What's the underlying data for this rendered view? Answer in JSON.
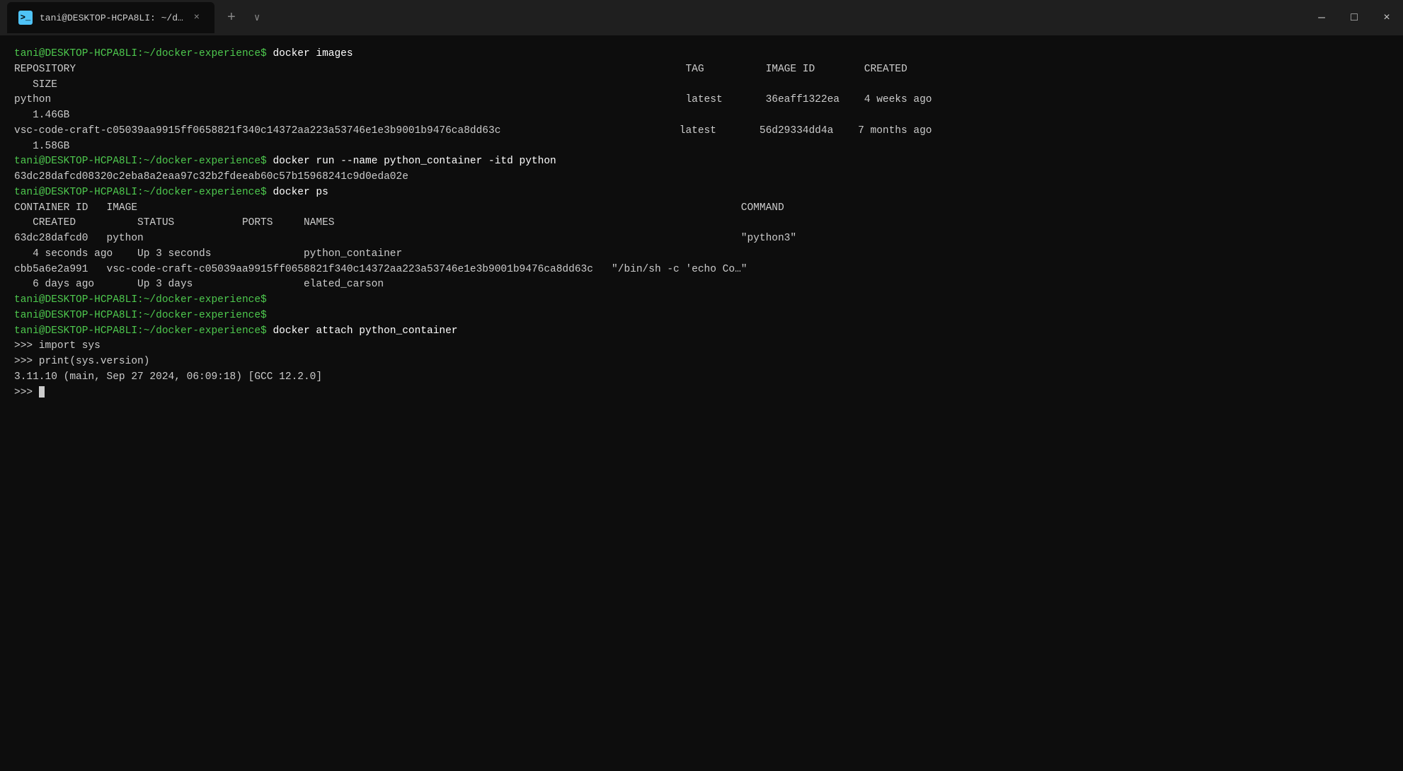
{
  "titlebar": {
    "tab_title": "tani@DESKTOP-HCPA8LI: ~/d…",
    "tab_icon": ">_",
    "close_label": "×",
    "minimize_label": "—",
    "maximize_label": "□",
    "new_tab_label": "+",
    "dropdown_label": "∨"
  },
  "terminal": {
    "prompt1": "tani@DESKTOP-HCPA8LI:~/docker-experience$",
    "cmd1": " docker images",
    "header_row": "REPOSITORY                                                                                                   TAG          IMAGE ID        CREATED",
    "header_size": "   SIZE",
    "img1_repo": "python",
    "img1_tag": "latest",
    "img1_id": "36eaff1322ea",
    "img1_created": "4 weeks ago",
    "img1_size": "   1.46GB",
    "img2_repo": "vsc-code-craft-c05039aa9915ff0658821f340c14372aa223a53746e1e3b9001b9476ca8dd63c",
    "img2_tag": "latest",
    "img2_id": "56d29334dd4a",
    "img2_created": "7 months ago",
    "img2_size": "   1.58GB",
    "prompt2": "tani@DESKTOP-HCPA8LI:~/docker-experience$",
    "cmd2": " docker run --name python_container -itd python",
    "container_hash": "63dc28dafcd08320c2eba8a2eaa97c32b2fdeeab60c57b15968241c9d0eda02e",
    "prompt3": "tani@DESKTOP-HCPA8LI:~/docker-experience$",
    "cmd3": " docker ps",
    "ps_header1": "CONTAINER ID   IMAGE                                                                                                  COMMAND",
    "ps_header2": "   CREATED          STATUS           PORTS     NAMES",
    "container1_id": "63dc28dafcd0",
    "container1_image": "python",
    "container1_command": "\"python3\"",
    "container1_created": "   4 seconds ago",
    "container1_status": "  Up 3 seconds",
    "container1_ports": "",
    "container1_names": "   python_container",
    "container2_id": "cbb5a6e2a991",
    "container2_image": "vsc-code-craft-c05039aa9915ff0658821f340c14372aa223a53746e1e3b9001b9476ca8dd63c",
    "container2_command": "\"/bin/sh -c 'echo Co…\"",
    "container2_created": "   6 days ago",
    "container2_status": "  Up 3 days",
    "container2_ports": "",
    "container2_names": "   elated_carson",
    "prompt4": "tani@DESKTOP-HCPA8LI:~/docker-experience$",
    "prompt5": "tani@DESKTOP-HCPA8LI:~/docker-experience$",
    "prompt6": "tani@DESKTOP-HCPA8LI:~/docker-experience$",
    "cmd6": " docker attach python_container",
    "repl1": ">>> import sys",
    "repl2": ">>> print(sys.version)",
    "repl_output": "3.11.10 (main, Sep 27 2024, 06:09:18) [GCC 12.2.0]",
    "repl3": ">>> "
  }
}
